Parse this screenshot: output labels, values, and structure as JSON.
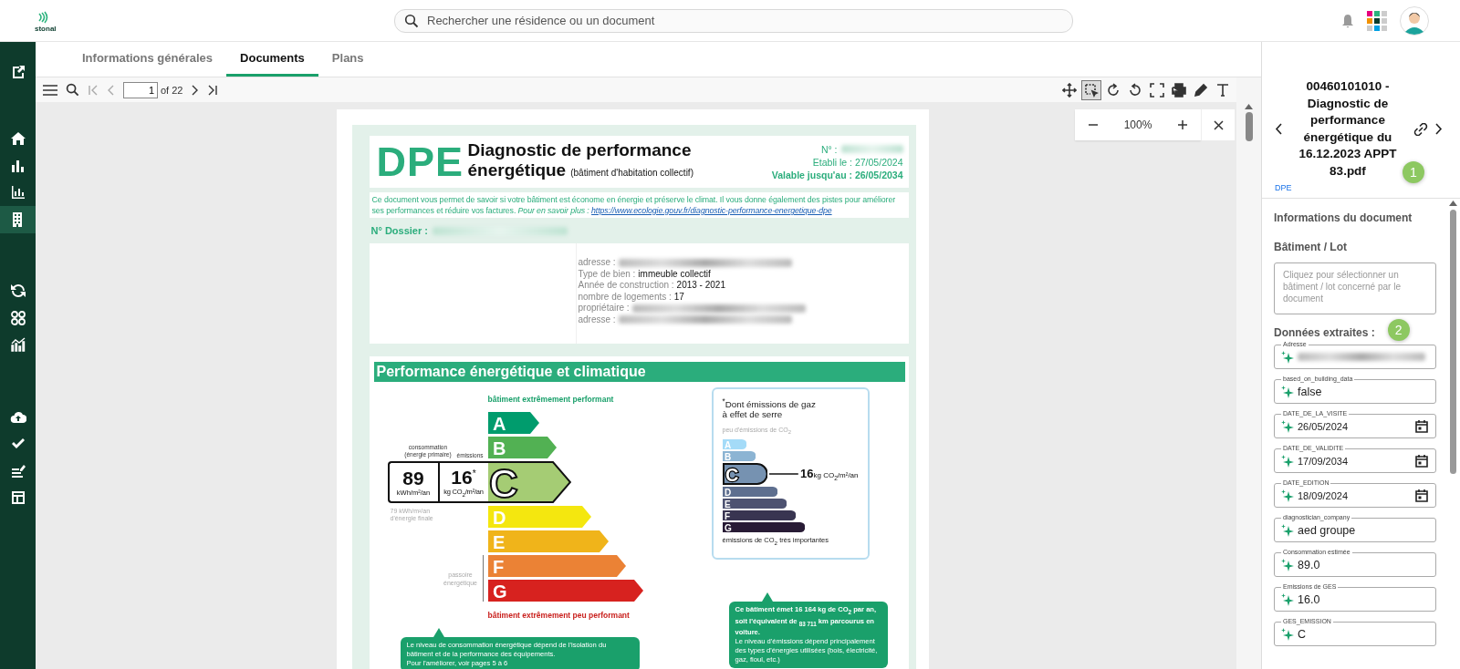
{
  "header": {
    "logo_text": "stonal",
    "search": {
      "placeholder": "Rechercher une résidence ou un document"
    }
  },
  "sidebar": {
    "items": [
      {
        "selected": false
      },
      {
        "selected": false
      },
      {
        "selected": false
      },
      {
        "selected": false
      },
      {
        "selected": true
      },
      {
        "selected": false
      },
      {
        "selected": false
      },
      {
        "selected": false
      },
      {
        "selected": false
      },
      {
        "selected": false
      },
      {
        "selected": false
      },
      {
        "selected": false
      }
    ]
  },
  "tabs": [
    {
      "label": "Informations générales",
      "selected": false
    },
    {
      "label": "Documents",
      "selected": true
    },
    {
      "label": "Plans",
      "selected": false
    }
  ],
  "viewer": {
    "page": "1",
    "page_count": "of 22",
    "tools": [
      {
        "selected": false
      },
      {
        "selected": true
      },
      {
        "selected": false
      },
      {
        "selected": false
      },
      {
        "selected": false
      },
      {
        "selected": false
      },
      {
        "selected": false
      },
      {
        "selected": false
      }
    ],
    "zoom": "100%"
  },
  "document": {
    "logo": "DPE",
    "title": "Diagnostic de performance",
    "title_2": "énergétique",
    "subtitle": "(bâtiment d'habitation collectif)",
    "number_label": "N° :",
    "established": "Etabli le : 27/05/2024",
    "valid_until": "Valable jusqu'au : 26/05/2034",
    "intro": "Ce document vous permet de savoir si votre bâtiment est économe en énergie et préserve le climat. Il vous donne également des pistes pour améliorer ses performances et réduire vos factures. *Pour en savoir plus :*",
    "link": "https://www.ecologie.gouv.fr/diagnostic-performance-energetique-dpe",
    "dossier_label": "N° Dossier :",
    "details": [
      {
        "label": "adresse :"
      },
      {
        "label": "Type de bien :",
        "value": "immeuble collectif"
      },
      {
        "label": "Année de construction :",
        "value": "2013 - 2021"
      },
      {
        "label": "nombre de logements :",
        "value": "17"
      },
      {
        "label": "propriétaire :"
      },
      {
        "label": "adresse :"
      }
    ],
    "section_title": "Performance énergétique et climatique",
    "energy": {
      "top_label": "bâtiment extrêmement performant",
      "bottom_label": "bâtiment extrêmement peu performant",
      "consumption_label": "consommation",
      "consumption_sub": "(énergie primaire)",
      "emissions_label": "émissions",
      "consumption": "89",
      "consumption_unit": "kWh/m²/an",
      "emissions": "16",
      "emissions_mark": "*",
      "emissions_unit": "kg CO$_{2}$/m²/an",
      "final": "79 kWh/m²/an d'énergie finale",
      "sieve": "passoire énergétique",
      "classes": [
        {
          "letter": "A",
          "color": "#009c6d",
          "selected": false
        },
        {
          "letter": "B",
          "color": "#52b153",
          "selected": false
        },
        {
          "letter": "C",
          "color": "#a5cc74",
          "selected": true
        },
        {
          "letter": "D",
          "color": "#f4e70f",
          "selected": false
        },
        {
          "letter": "E",
          "color": "#f0b41a",
          "selected": false
        },
        {
          "letter": "F",
          "color": "#eb8235",
          "selected": false
        },
        {
          "letter": "G",
          "color": "#d7221f",
          "selected": false
        }
      ]
    },
    "ges": {
      "title": "$^{*}$Dont émissions de gaz à effet de serre",
      "low": "peu d'émissions de CO$_{2}$",
      "high": "émissions de CO$_{2}$ très importantes",
      "value": "16",
      "unit": "kg CO$_{2}$/m²/an",
      "classes": [
        {
          "letter": "A",
          "color": "#a4dbf8",
          "selected": false
        },
        {
          "letter": "B",
          "color": "#8cb4d3",
          "selected": false
        },
        {
          "letter": "C",
          "color": "#7692b1",
          "selected": true
        },
        {
          "letter": "D",
          "color": "#5e6f8f",
          "selected": false
        },
        {
          "letter": "E",
          "color": "#4d5271",
          "selected": false
        },
        {
          "letter": "F",
          "color": "#393551",
          "selected": false
        },
        {
          "letter": "G",
          "color": "#281b35",
          "selected": false
        }
      ]
    },
    "callouts": [
      {
        "text": "Le niveau de consommation énergétique dépend de l'isolation du bâtiment et de la performance des équipements.\nPour l'améliorer, voir pages 5 à 6"
      },
      {
        "text": "**Ce bâtiment émet 16 164 kg de CO$_{2}$ par an, soit l'équivalent de $_{83 711}$ km parcourus en voiture.**\nLe niveau d'émissions dépend principalement des types d'énergies utilisées (bois, électricité, gaz, fioul, etc.)"
      }
    ]
  },
  "panel": {
    "title": "00460101010 - Diagnostic de performance énergétique du 16.12.2023 APPT 83.pdf",
    "title_badge": "1",
    "type": "DPE",
    "section": "Informations du document",
    "building_label": "Bâtiment / Lot",
    "building_field": {
      "placeholder": "Cliquez pour sélectionner un bâtiment / lot concerné par le document"
    },
    "extracted_label": "Données extraites :",
    "extracted_badge": "2",
    "fields": [
      {
        "label": "Adresse",
        "kind": "text"
      },
      {
        "label": "based_on_building_data",
        "kind": "text",
        "value": "false"
      },
      {
        "label": "DATE_DE_LA_VISITE",
        "kind": "date",
        "value": "26/05/2024"
      },
      {
        "label": "DATE_DE_VALIDITE",
        "kind": "date",
        "value": "17/09/2034"
      },
      {
        "label": "DATE_EDITION",
        "kind": "date",
        "value": "18/09/2024"
      },
      {
        "label": "diagnostician_company",
        "kind": "text",
        "value": "aed groupe"
      },
      {
        "label": "Consommation estimée",
        "kind": "text",
        "value": "89.0"
      },
      {
        "label": "Emissions de GES",
        "kind": "text",
        "value": "16.0"
      },
      {
        "label": "GES_EMISSION",
        "kind": "text",
        "value": "C"
      }
    ]
  }
}
